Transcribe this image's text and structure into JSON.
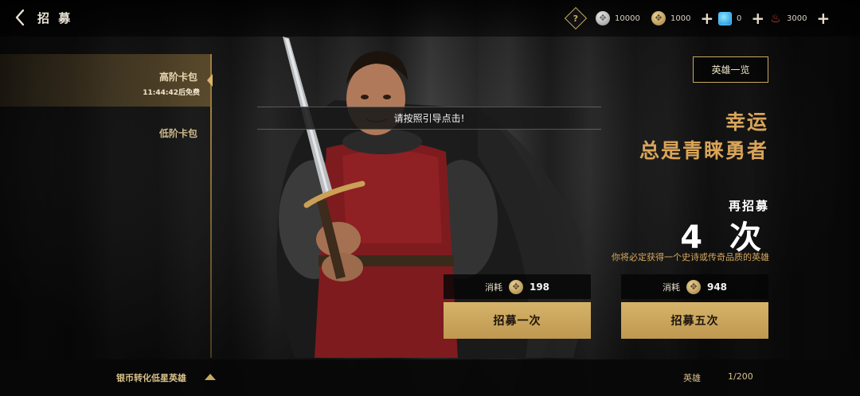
{
  "header": {
    "title": "招 募",
    "resources": [
      {
        "icon": "silver-coin-icon",
        "value": "10000"
      },
      {
        "icon": "gold-coin-icon",
        "value": "1000"
      },
      {
        "icon": "blue-gem-icon",
        "value": "0"
      },
      {
        "icon": "fire-icon",
        "value": "3000"
      }
    ]
  },
  "sidebar": {
    "tabs": [
      {
        "label": "高阶卡包",
        "timer": "11:44:42后免费",
        "active": true
      },
      {
        "label": "低阶卡包",
        "active": false
      }
    ]
  },
  "guide": {
    "text": "请按照引导点击!"
  },
  "right_panel": {
    "hero_list_label": "英雄一览",
    "slogan_line1": "幸运",
    "slogan_line2": "总是青睐勇者",
    "again_label": "再招募",
    "count_text": "4 次",
    "guarantee_text": "你将必定获得一个史诗或传奇品质的英雄",
    "single": {
      "cost_label": "消耗",
      "cost_value": "198",
      "button_label": "招募一次"
    },
    "five": {
      "cost_label": "消耗",
      "cost_value": "948",
      "button_label": "招募五次"
    }
  },
  "footer": {
    "convert_label": "银币转化低星英雄",
    "hero_label": "英雄",
    "hero_count": "1/200"
  },
  "colors": {
    "accent_gold": "#c9a961",
    "slogan_gold": "#d9a55a",
    "button_gold": "#d6b36a"
  }
}
